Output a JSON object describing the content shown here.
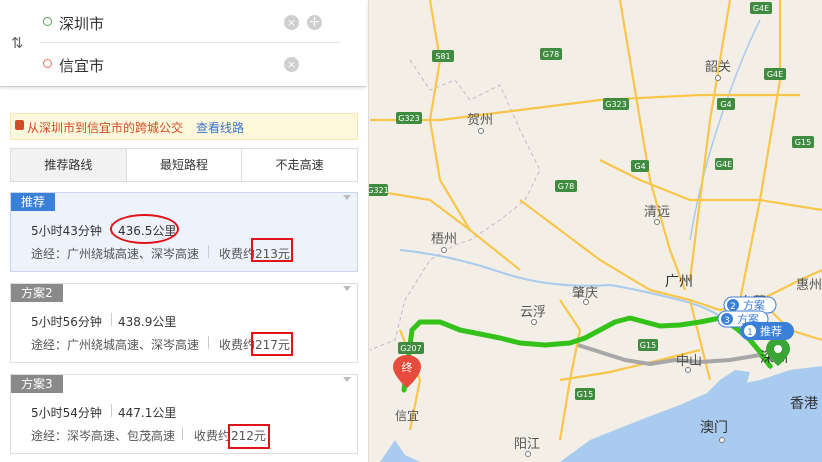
{
  "search": {
    "from": "深圳市",
    "to": "信宜市",
    "clear_icon": "×",
    "add_icon": "+"
  },
  "bus_tip": {
    "text": "从深圳市到信宜市的跨城公交",
    "link": "查看线路"
  },
  "tabs": [
    "推荐路线",
    "最短路程",
    "不走高速"
  ],
  "routes": [
    {
      "tag": "推荐",
      "time": "5小时43分钟",
      "distance": "436.5公里",
      "via": "途经：广州绕城高速、深岑高速",
      "toll_label": "收费约",
      "toll": "213元"
    },
    {
      "tag": "方案2",
      "time": "5小时56分钟",
      "distance": "438.9公里",
      "via": "途经：广州绕城高速、深岑高速",
      "toll_label": "收费约",
      "toll": "217元"
    },
    {
      "tag": "方案3",
      "time": "5小时54分钟",
      "distance": "447.1公里",
      "via": "途经：深岑高速、包茂高速",
      "toll_label": "收费约",
      "toll": "212元"
    }
  ],
  "map": {
    "cities": [
      "贺州",
      "韶关",
      "清远",
      "梧州",
      "广州",
      "肇庆",
      "云浮",
      "惠州",
      "东莞",
      "深圳",
      "香港",
      "澳门",
      "中山",
      "阳江",
      "信宜"
    ],
    "road_shields": [
      "S81",
      "G323",
      "G323",
      "G78",
      "G78",
      "G4",
      "G4",
      "G4E",
      "G4E",
      "G4E",
      "G321",
      "G207",
      "G15",
      "G15",
      "G15"
    ],
    "markers": {
      "end": "终",
      "plan2": "方案",
      "plan2_num": "2",
      "plan3": "方案",
      "plan3_num": "3",
      "rec": "推荐",
      "rec_num": "1"
    },
    "colors": {
      "land": "#f3efe6",
      "water": "#a8cbef",
      "route_main": "#34c21a",
      "route_alt": "#a7a7a7",
      "highway": "#f8c64b",
      "shield": "#3f8b3f"
    }
  }
}
